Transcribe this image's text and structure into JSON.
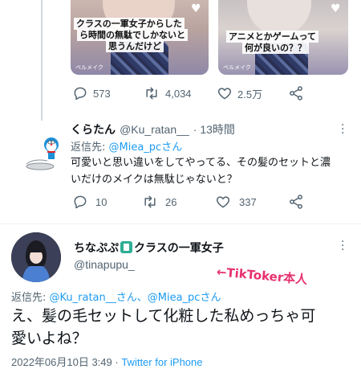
{
  "media": {
    "thumb1": {
      "caption_lines": [
        "クラスの一軍女子からした",
        "ら時間の無駄でしかないと",
        "思うんだけど"
      ],
      "tag": "ベルメイク"
    },
    "thumb2": {
      "caption_lines": [
        "アニメとかゲームって",
        "何が良いの？？"
      ],
      "tag": "ベルメイク"
    }
  },
  "top_actions": {
    "reply_count": "573",
    "retweet_count": "4,034",
    "like_count": "2.5万"
  },
  "reply_tweet": {
    "name": "くらたん",
    "handle": "@Ku_ratan__",
    "time": "· 13時間",
    "replying_label": "返信先: ",
    "replying_to": "@Miea_pcさん",
    "text_line1": "可愛いと思い違いをしてやってる、その髪のセットと濃",
    "text_line2": "いだけのメイクは無駄じゃないと？",
    "reply_count": "10",
    "retweet_count": "26",
    "like_count": "337"
  },
  "main_tweet": {
    "name": "ちなぷぷ",
    "name_suffix": "クラスの一軍女子",
    "handle": "@tinapupu_",
    "annotation": "←TikToker本人",
    "replying_label": "返信先: ",
    "replying_to_1": "@Ku_ratan__さん",
    "replying_sep": "、",
    "replying_to_2": "@Miea_pcさん",
    "text_line1": "え、髪の毛セットして化粧した私めっちゃ可",
    "text_line2": "愛いよね？",
    "timestamp": "2022年06月10日 3:49",
    "dot": " · ",
    "client": "Twitter for iPhone"
  },
  "colors": {
    "accent": "#1d9bf0",
    "muted": "#536471",
    "annotation": "#e8306f"
  }
}
